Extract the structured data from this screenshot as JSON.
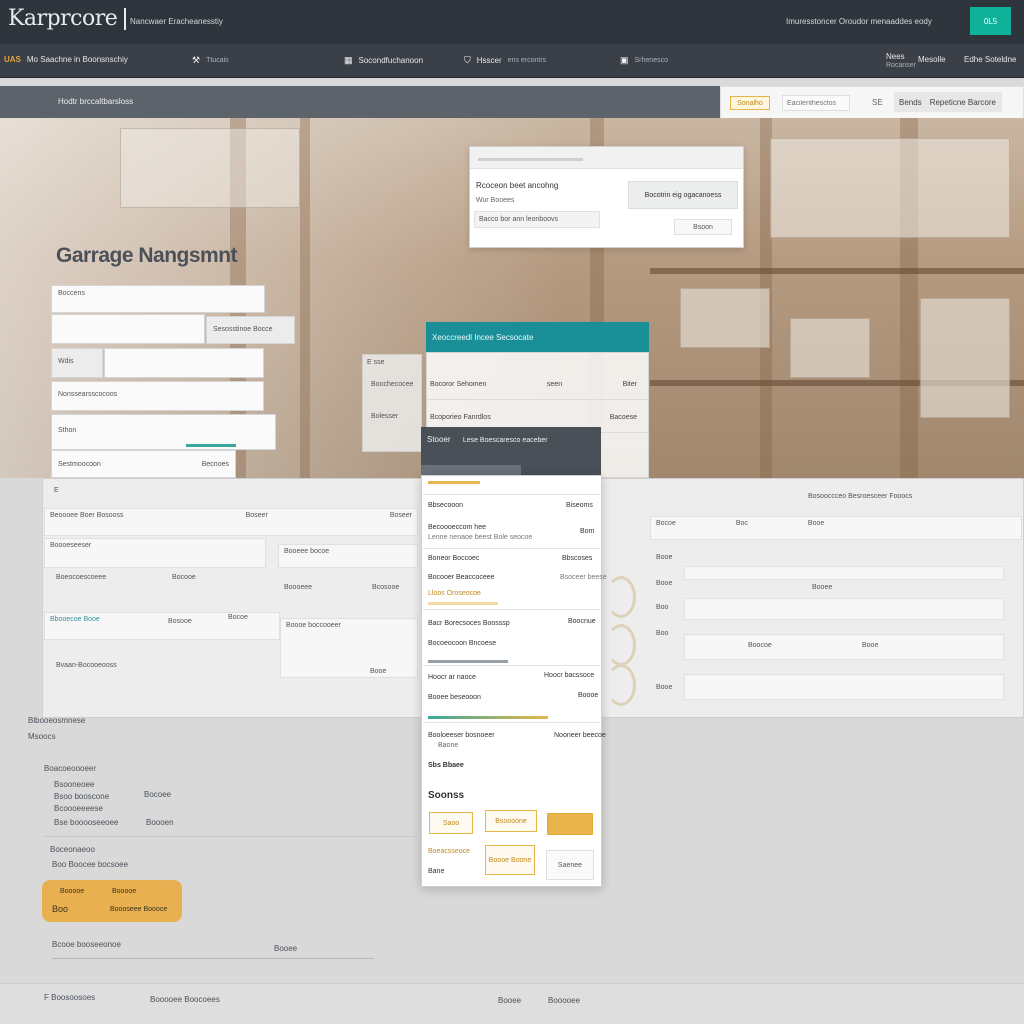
{
  "header": {
    "logo": "Karprcore",
    "tagline": "Nancwaer Eracheanesstiy",
    "right_text": "Imuresstoncer Oroudor menaaddes eody",
    "action_button": "0L5"
  },
  "nav": {
    "badge": "UAS",
    "primary": "Mo Saachne in Boonsnschiy",
    "items": [
      {
        "icon": "wrench-icon",
        "glyph": "⚒",
        "label": "Ttucais"
      },
      {
        "icon": "calendar-icon",
        "glyph": "▦",
        "label": "Socondfuchanoon"
      },
      {
        "icon": "shield-icon",
        "glyph": "⛉",
        "label": "Hsscer",
        "sub": "ens ercontrs"
      },
      {
        "icon": "car-icon",
        "glyph": "▣",
        "label": "Srhenesco"
      }
    ],
    "right": [
      {
        "label": "Nees",
        "sub": "Rocanser"
      },
      {
        "label": "Mesolle"
      },
      {
        "label": "Edhe Soteldne"
      }
    ]
  },
  "subbar": {
    "text": "Hodtr brccaltbarsloss"
  },
  "toolbar": {
    "filter_label": "Sonalho",
    "search_placeholder": "Eacilenthesctos",
    "sort_label": "SE",
    "select_label": "Bends",
    "select_value": "Repeticne Barcore"
  },
  "hero": {
    "title": "Garrage Nangsmnt"
  },
  "left_form": {
    "field1": "Boccens",
    "field2_tag": "Sesosstinoe Bocce",
    "field3_tag": "Wdis",
    "field4": "Nonssearsscocoos",
    "field5": "Sthon",
    "field6_label": "Sestmoocoon",
    "field6_value": "Becnoes"
  },
  "dialog": {
    "title": "Rcoceon beet ancohng",
    "subtitle": "Wur Booees",
    "input": "Bacco bor ann leonboovs",
    "primary_button": "Bocotrin eig ogacanoess",
    "secondary_button": "Bsoon"
  },
  "center_table": {
    "header": "Xeoccreedl Incee Secsocate",
    "side_label": "E sse",
    "side_row1": "Boochecocee",
    "side_row2": "Bolesser",
    "rows": [
      {
        "left": "Bocoror Sehomen",
        "mid": "seen",
        "right": "Biter"
      },
      {
        "left": "Bcoporieo Fanrdlos",
        "mid": "",
        "right": "Bacoese"
      }
    ]
  },
  "phone": {
    "head_title": "Stooer",
    "head_text": "Lese Boescaresco eaceber",
    "rows": [
      {
        "left": "Bbsecooon",
        "right": "Biseoms"
      },
      {
        "left": "Becoooeccom hee",
        "right": "Bom",
        "sub": "Lenne nenaoe beest  Bole seocoe"
      },
      {
        "left": "Boneor Boccoec",
        "right": "Bbscoses"
      },
      {
        "left": "Bocooer Beaccoceee",
        "right": "Bsoceer beese",
        "sub": "Lloos Oroseocoe"
      },
      {
        "left": "Bacr Borecsoces Boosssp",
        "right": "Boocnue"
      },
      {
        "left": "Bocoeocoon Bncoese",
        "right": ""
      },
      {
        "left": "Hoocr ar naoce",
        "right": "Hoocr bacssoce"
      },
      {
        "left": "Booee beseooon",
        "right": "Boooe"
      },
      {
        "left": "Booloeeser bosnoeer",
        "right": "Nooneer beecoe",
        "sub": "Baone"
      },
      {
        "left": "Sbs Bbaee",
        "right": ""
      }
    ],
    "section_title": "Soonss",
    "buttons": [
      "Saoo",
      "Bsoooone",
      ""
    ],
    "lower_left": "Boeacsseoce",
    "lower_left2": "Bane",
    "lower_mid": "Boooe Boone",
    "lower_right": "Saenee"
  },
  "board": {
    "corner": "E",
    "right_title": "Bosooccceo Besroesceer Fooocs",
    "left_rows": [
      {
        "a": "Beoooee Boer Bosooss",
        "b": "Boseer",
        "c": "Boseer"
      },
      {
        "a": "Boooeseeser",
        "b": "Booeee bocoe",
        "c": "Bcosooe"
      },
      {
        "a": "Boeocoescoeee",
        "b": "Bocooe",
        "c": "Boooeee"
      },
      {
        "a": "Bbooecoe Booe",
        "b": "Bosooe",
        "c": "Bocoe"
      },
      {
        "a": "Bvaan-Bocooeooss",
        "b": "Boooe boccooeer",
        "c": "Booe"
      }
    ],
    "right_rows": [
      {
        "a": "Bocoe",
        "b": "Boc",
        "c": "Booe"
      },
      {
        "a": "Booe",
        "b": "",
        "c": ""
      },
      {
        "a": "Booe",
        "b": "Booee",
        "c": ""
      },
      {
        "a": "Boo",
        "b": "Boocoe",
        "c": "Booe"
      },
      {
        "a": "Boo",
        "b": "",
        "c": ""
      },
      {
        "a": "Booe",
        "b": "",
        "c": ""
      }
    ]
  },
  "lower": {
    "line1": "Blbooeosmnese",
    "line2": "Msoocs",
    "section": "Boacoeoooeer",
    "list": [
      {
        "k": "Bsooneoee",
        "v": "Bocoee"
      },
      {
        "k": "Bsoo booscone",
        "v": ""
      },
      {
        "k": "Bcoooeeeese",
        "v": ""
      },
      {
        "k": "Bse booooseeoee",
        "v": "Boooen"
      }
    ],
    "note1": "Boceonaeoo",
    "note2": "Boo Boocee bocsoee",
    "promo_top_left": "Booooe",
    "promo_top_right": "Booooe",
    "promo_bottom_left": "Boo",
    "promo_bottom_right": "Boooseee Boooce",
    "footer_row_left": "Bcooe booseeonoe",
    "footer_row_right": "Booee"
  },
  "footer": {
    "left": "F Boosoosoes",
    "mid": "Booooee Boocoees",
    "right1": "Booee",
    "right2": "Booooee"
  }
}
